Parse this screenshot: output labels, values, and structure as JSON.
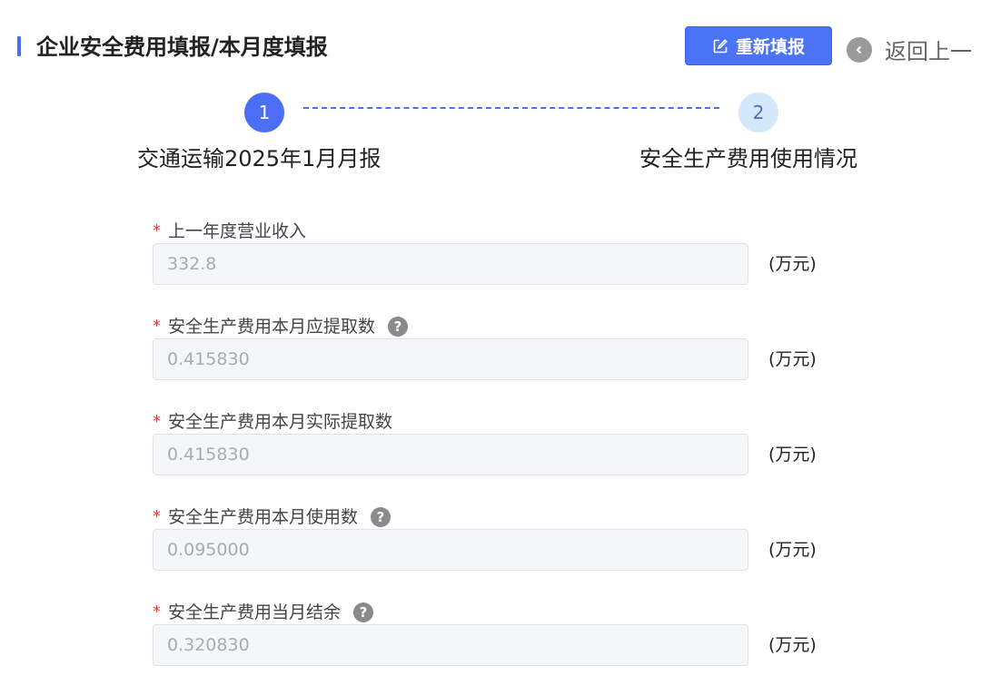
{
  "header": {
    "title": "企业安全费用填报/本月度填报",
    "refill_label": "重新填报",
    "back_label": "返回上一"
  },
  "steps": [
    {
      "number": "1",
      "label": "交通运输2025年1月月报"
    },
    {
      "number": "2",
      "label": "安全生产费用使用情况"
    }
  ],
  "form": {
    "required_mark": "*",
    "help_mark": "?",
    "fields": [
      {
        "label": "上一年度营业收入",
        "value": "332.8",
        "unit": "(万元)"
      },
      {
        "label": "安全生产费用本月应提取数",
        "value": "0.415830",
        "unit": "(万元)"
      },
      {
        "label": "安全生产费用本月实际提取数",
        "value": "0.415830",
        "unit": "(万元)"
      },
      {
        "label": "安全生产费用本月使用数",
        "value": "0.095000",
        "unit": "(万元)"
      },
      {
        "label": "安全生产费用当月结余",
        "value": "0.320830",
        "unit": "(万元)"
      }
    ]
  },
  "colors": {
    "accent": "#4b6ef5",
    "required": "#e23c3c",
    "step_inactive": "#d3e9fb"
  }
}
